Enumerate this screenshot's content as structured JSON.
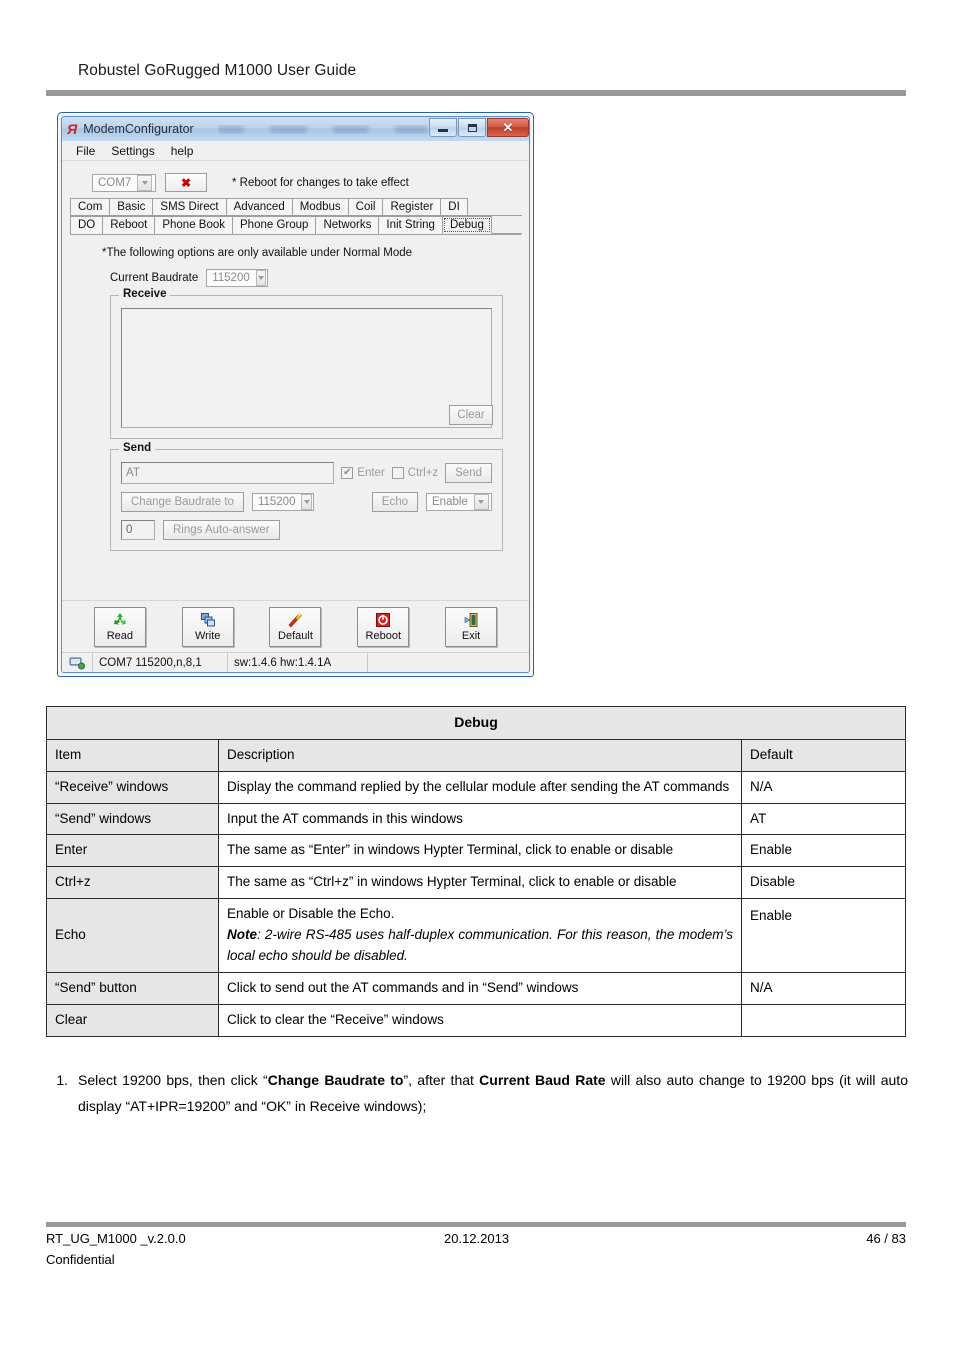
{
  "page": {
    "doc_title": "Robustel GoRugged M1000 User Guide"
  },
  "app_window": {
    "title": "ModemConfigurator",
    "logo_text": "Я",
    "window_buttons": {
      "minimize": "minimize-icon",
      "maximize": "maximize-icon",
      "close": "✕"
    },
    "menu": [
      "File",
      "Settings",
      "help"
    ],
    "com_port": "COM7",
    "disconnect_label": "✖",
    "reboot_note": "* Reboot for changes to take effect",
    "tabs_row1": [
      "Com",
      "Basic",
      "SMS Direct",
      "Advanced",
      "Modbus",
      "Coil",
      "Register",
      "DI"
    ],
    "tabs_row2": [
      "DO",
      "Reboot",
      "Phone Book",
      "Phone Group",
      "Networks",
      "Init String",
      "Debug"
    ],
    "active_tab": "Debug",
    "panel": {
      "normal_mode_note": "*The following options are only available under Normal Mode",
      "current_baudrate_label": "Current Baudrate",
      "current_baudrate_value": "115200",
      "receive_legend": "Receive",
      "receive_text": "",
      "clear_label": "Clear",
      "send_legend": "Send",
      "send_value": "AT",
      "enter_label": "Enter",
      "enter_checked": "✔",
      "ctrlz_label": "Ctrl+z",
      "send_button_label": "Send",
      "change_baudrate_label": "Change Baudrate to",
      "change_baudrate_value": "115200",
      "echo_label": "Echo",
      "echo_value": "Enable",
      "rings_value": "0",
      "rings_label": "Rings Auto-answer"
    },
    "toolbar": [
      {
        "label": "Read",
        "icon": "recycle-icon"
      },
      {
        "label": "Write",
        "icon": "windows-stack-icon"
      },
      {
        "label": "Default",
        "icon": "tools-icon"
      },
      {
        "label": "Reboot",
        "icon": "power-icon"
      },
      {
        "label": "Exit",
        "icon": "exit-door-icon"
      }
    ],
    "statusbar": {
      "icon": "network-icon",
      "connection": "COM7 115200,n,8,1",
      "versions": "sw:1.4.6 hw:1.4.1A",
      "extra": ""
    }
  },
  "table": {
    "caption": "Debug",
    "columns": [
      "Item",
      "Description",
      "Default"
    ],
    "rows": [
      {
        "item": "“Receive” windows",
        "description": "Display the command replied by the cellular module after sending the AT commands",
        "default": "N/A"
      },
      {
        "item": "“Send” windows",
        "description": "Input the AT commands in this windows",
        "default": "AT"
      },
      {
        "item": "Enter",
        "description": "The same as “Enter” in windows Hypter Terminal, click to enable or disable",
        "default": "Enable"
      },
      {
        "item": "Ctrl+z",
        "description": "The same as “Ctrl+z” in windows Hypter Terminal, click to enable or disable",
        "default": "Disable"
      },
      {
        "item": "Echo",
        "description_line1": "Enable or Disable the Echo.",
        "description_note_label": "Note",
        "description_note": ": 2-wire RS-485 uses half-duplex communication. For this reason, the modem’s local echo should be disabled.",
        "default": "Enable"
      },
      {
        "item": "“Send” button",
        "description": "Click to send out the AT commands and in “Send” windows",
        "default": "N/A"
      },
      {
        "item": "Clear",
        "description": "Click to clear the “Receive” windows",
        "default": ""
      }
    ]
  },
  "paragraph": {
    "number": "1.",
    "part1": "Select 19200 bps, then click “",
    "bold1": "Change Baudrate to",
    "part2": "”, after that ",
    "bold2": "Current Baud Rate",
    "part3": " will also auto change to 19200 bps (it will auto display “AT+IPR=19200” and “OK” in Receive windows);"
  },
  "footer": {
    "left": "RT_UG_M1000 _v.2.0.0",
    "center": "20.12.2013",
    "right": "46 / 83",
    "confidential": "Confidential"
  }
}
